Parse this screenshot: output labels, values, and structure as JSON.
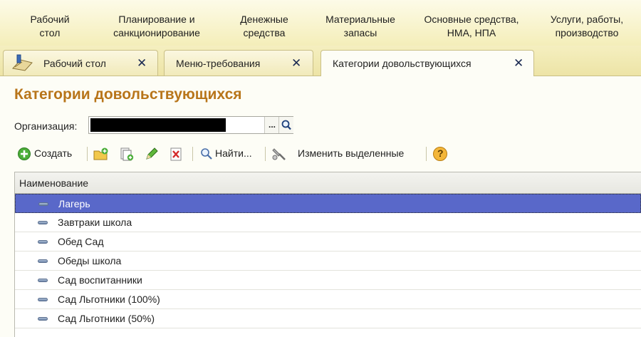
{
  "top_menu": {
    "items": [
      "Рабочий\nстол",
      "Планирование и\nсанкционирование",
      "Денежные\nсредства",
      "Материальные\nзапасы",
      "Основные средства,\nНМА, НПА",
      "Услуги, работы,\nпроизводство"
    ]
  },
  "tabs": [
    {
      "label": "Рабочий стол",
      "close": "✕"
    },
    {
      "label": "Меню-требования",
      "close": "✕"
    },
    {
      "label": "Категории довольствующихся",
      "close": "✕"
    }
  ],
  "page": {
    "title": "Категории довольствующихся",
    "organization_label": "Организация:",
    "organization_value": "",
    "select_button": "..."
  },
  "toolbar": {
    "create_label": "Создать",
    "find_label": "Найти...",
    "edit_selected_label": "Изменить выделенные",
    "help_label": "?"
  },
  "table": {
    "header": "Наименование",
    "rows": [
      "Лагерь",
      "Завтраки школа",
      "Обед Сад",
      "Обеды школа",
      "Сад воспитанники",
      "Сад Льготники (100%)",
      "Сад Льготники (50%)"
    ],
    "selected_index": 0
  },
  "colors": {
    "title": "#b8751a",
    "selection": "#5968c9",
    "menu_bg": "#f4eeb9"
  },
  "icons": [
    "desktop-icon",
    "close-icon",
    "search-icon",
    "create-icon",
    "add-group-icon",
    "copy-icon",
    "edit-icon",
    "delete-icon",
    "find-icon",
    "edit-selected-icon",
    "help-icon",
    "row-marker-icon"
  ]
}
